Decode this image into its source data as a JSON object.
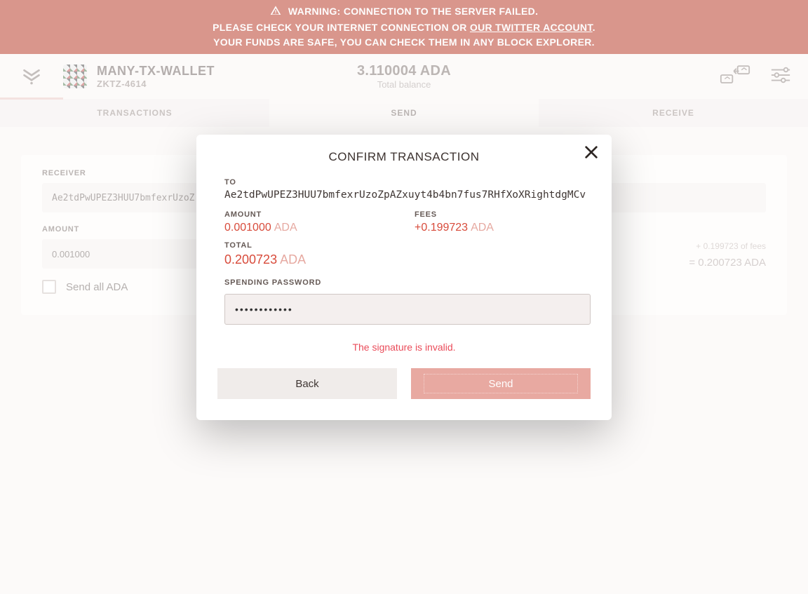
{
  "warning": {
    "line1": "WARNING: CONNECTION TO THE SERVER FAILED.",
    "line2a": "PLEASE CHECK YOUR INTERNET CONNECTION OR ",
    "line2link": "OUR TWITTER ACCOUNT",
    "line2b": ".",
    "line3": "YOUR FUNDS ARE SAFE, YOU CAN CHECK THEM IN ANY BLOCK EXPLORER."
  },
  "wallet": {
    "name": "MANY-TX-WALLET",
    "code": "ZKTZ-4614"
  },
  "balance": {
    "amount": "3.110004 ADA",
    "label": "Total balance"
  },
  "tabs": {
    "transactions": "TRANSACTIONS",
    "send": "SEND",
    "receive": "RECEIVE"
  },
  "form": {
    "receiver_label": "RECEIVER",
    "receiver_value": "Ae2tdPwUPEZ3HUU7bmfexrUzoZ",
    "amount_label": "AMOUNT",
    "amount_value": "0.001000",
    "fee_hint": "+ 0.199723 of fees",
    "total_hint": "= 0.200723 ADA",
    "send_all_label": "Send all ADA"
  },
  "modal": {
    "title": "CONFIRM TRANSACTION",
    "to_label": "TO",
    "to_value": "Ae2tdPwUPEZ3HUU7bmfexrUzoZpAZxuyt4b4bn7fus7RHfXoXRightdgMCv",
    "amount_label": "AMOUNT",
    "amount_value": "0.001000",
    "amount_currency": "ADA",
    "fees_label": "FEES",
    "fees_value": "+0.199723",
    "fees_currency": "ADA",
    "total_label": "TOTAL",
    "total_value": "0.200723",
    "total_currency": "ADA",
    "password_label": "SPENDING PASSWORD",
    "password_value": "••••••••••••",
    "error": "The signature is invalid.",
    "back": "Back",
    "send": "Send"
  }
}
